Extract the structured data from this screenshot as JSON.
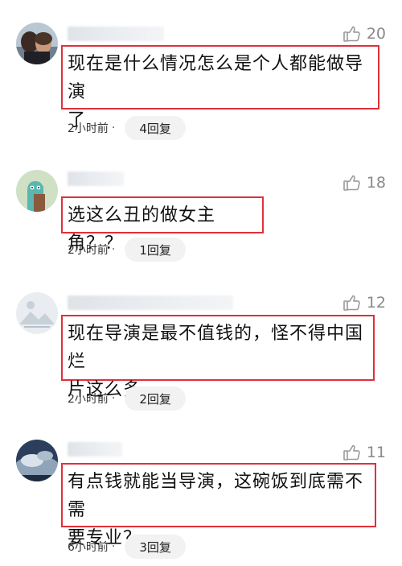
{
  "comments": [
    {
      "likes": "20",
      "text": "现在是什么情况怎么是个人都能做导演\n了",
      "time": "2小时前",
      "separator": "·",
      "replies": "4回复"
    },
    {
      "likes": "18",
      "text": "选这么丑的做女主角？？",
      "time": "2小时前",
      "separator": "·",
      "replies": "1回复"
    },
    {
      "likes": "12",
      "text": "现在导演是最不值钱的，怪不得中国烂\n片这么多",
      "time": "2小时前",
      "separator": "·",
      "replies": "2回复"
    },
    {
      "likes": "11",
      "text": "有点钱就能当导演，这碗饭到底需不需\n要专业？",
      "time": "6小时前",
      "separator": "·",
      "replies": "3回复"
    }
  ],
  "icons": {
    "like": "thumbs-up-icon"
  },
  "colors": {
    "highlight_border": "#e0303b",
    "meta_text": "#333333",
    "like_text": "#8a8a8a",
    "reply_button_bg": "#f2f2f2"
  }
}
